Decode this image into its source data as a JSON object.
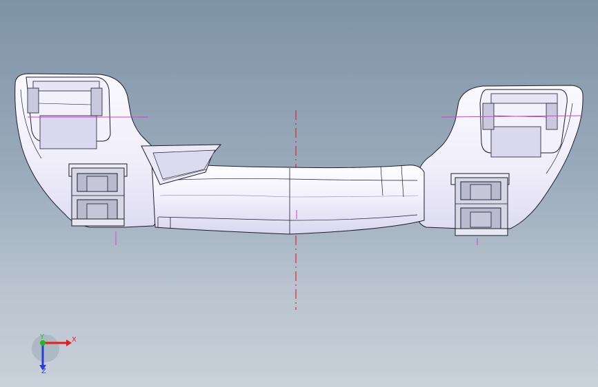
{
  "viewport": {
    "background_top": "#7f93a7",
    "background_bottom": "#c9d1da"
  },
  "model": {
    "body_fill": "#f4f2fb",
    "shade_fill": "#dcdaf0",
    "edge_color": "#1b1b2a",
    "clip_fill": "#cfd0de",
    "centerline_color": "#e0203a",
    "sketch_color": "#d63cd6"
  },
  "triad": {
    "x_label": "X",
    "y_label": "Y",
    "z_label": "Z",
    "x_color": "#e81c1c",
    "y_color": "#1fb81f",
    "z_color": "#2a3bd8"
  }
}
